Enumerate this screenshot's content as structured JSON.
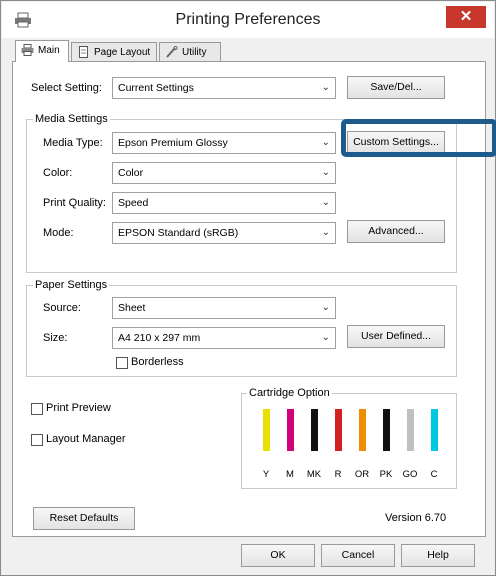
{
  "window": {
    "title": "Printing Preferences",
    "close_glyph": "✕"
  },
  "tabs": [
    {
      "label": "Main",
      "icon": "printer-icon"
    },
    {
      "label": "Page Layout",
      "icon": "page-icon"
    },
    {
      "label": "Utility",
      "icon": "wrench-icon"
    }
  ],
  "select_setting": {
    "label": "Select Setting:",
    "value": "Current Settings",
    "button": "Save/Del..."
  },
  "media": {
    "group_title": "Media Settings",
    "media_type_label": "Media Type:",
    "media_type_value": "Epson Premium Glossy",
    "custom_button": "Custom Settings...",
    "color_label": "Color:",
    "color_value": "Color",
    "quality_label": "Print Quality:",
    "quality_value": "Speed",
    "mode_label": "Mode:",
    "mode_value": "EPSON Standard (sRGB)",
    "advanced_button": "Advanced..."
  },
  "paper": {
    "group_title": "Paper Settings",
    "source_label": "Source:",
    "source_value": "Sheet",
    "size_label": "Size:",
    "size_value": "A4 210 x 297 mm",
    "user_defined_button": "User Defined...",
    "borderless_label": "Borderless"
  },
  "options": {
    "print_preview": "Print Preview",
    "layout_manager": "Layout Manager"
  },
  "cartridge": {
    "title": "Cartridge Option",
    "inks": [
      {
        "label": "Y",
        "color": "#e8e000"
      },
      {
        "label": "M",
        "color": "#d4007a"
      },
      {
        "label": "MK",
        "color": "#111111"
      },
      {
        "label": "R",
        "color": "#d31f1f"
      },
      {
        "label": "OR",
        "color": "#f08c00"
      },
      {
        "label": "PK",
        "color": "#111111"
      },
      {
        "label": "GO",
        "color": "#c0c0c0"
      },
      {
        "label": "C",
        "color": "#00c8e0"
      }
    ]
  },
  "footer": {
    "reset": "Reset Defaults",
    "version": "Version 6.70"
  },
  "dialog_buttons": {
    "ok": "OK",
    "cancel": "Cancel",
    "help": "Help"
  },
  "colors": {
    "highlight": "#1e5b8d",
    "close": "#c7372b"
  }
}
